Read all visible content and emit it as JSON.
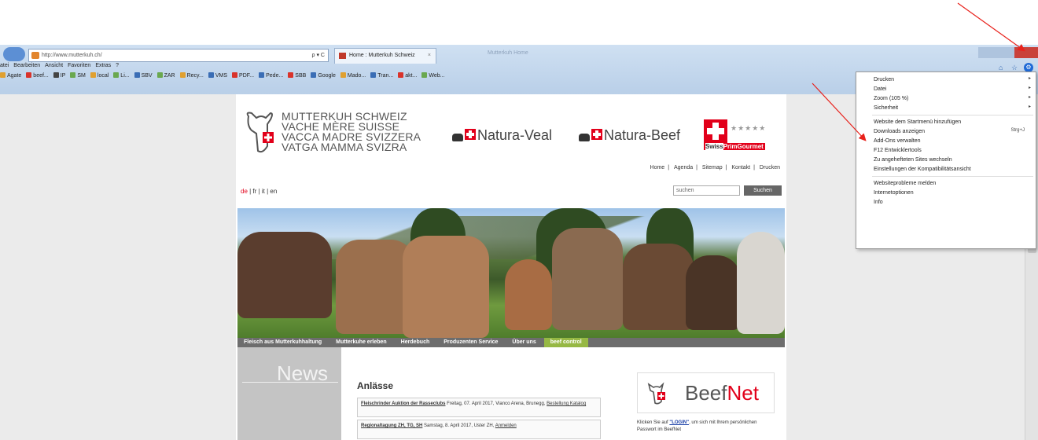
{
  "browser": {
    "address": "http://www.mutterkuh.ch/",
    "address_controls": "ρ ▾ C",
    "tab_label": "Home : Mutterkuh Schweiz",
    "tab_close": "×",
    "window_title": "Mutterkuh Home",
    "menu": [
      "atei",
      "Bearbeiten",
      "Ansicht",
      "Favoriten",
      "Extras",
      "?"
    ],
    "favorites": [
      "Agate",
      "beef...",
      "IP",
      "SM",
      "local",
      "Li...",
      "SBV",
      "ZAR",
      "Recy...",
      "VMS",
      "PDF...",
      "Pede...",
      "SBB",
      "Google",
      "Mado...",
      "Tran...",
      "akt...",
      "Web..."
    ]
  },
  "site": {
    "logo_lines": [
      "MUTTERKUH SCHWEIZ",
      "VACHE MÈRE SUISSE",
      "VACCA MADRE SVIZZERA",
      "VATGA MAMMA SVIZRA"
    ],
    "brand_veal": "Natura-Veal",
    "brand_beef": "Natura-Beef",
    "brand_spg_stars": "★★★★★",
    "brand_spg_label": "Swiss",
    "brand_spg_label2": "PrimGourmet",
    "topnav": [
      "Home",
      "Agenda",
      "Sitemap",
      "Kontakt",
      "Drucken"
    ],
    "topnav_sep": "|",
    "lang_active": "de",
    "lang_rest": " | fr | it | en",
    "search_placeholder": "suchen",
    "search_button": "Suchen",
    "menu": [
      "Fleisch aus Mutterkuhhaltung",
      "Mutterkuhe erleben",
      "Herdebuch",
      "Produzenten Service",
      "Über uns",
      "beef control"
    ],
    "news_title": "News",
    "anlaesse_title": "Anlässe",
    "events": [
      {
        "link": "Fleischrinder Auktion der Rasseclubs",
        "text": " Freitag, 07. April 2017, Vianco Arena, Brunegg, ",
        "extra": "Bestellung Katalog"
      },
      {
        "link": "Regionaltagung ZH, TG, SH",
        "text": " Samstag, 8. April 2017, Uster ZH, ",
        "extra": "Anmelden"
      }
    ],
    "beefnet_a": "Beef",
    "beefnet_b": "Net",
    "beefnet_text_a": "Klicken Sie auf ",
    "beefnet_text_login": "\"LOGIN\"",
    "beefnet_text_b": ", um sich mit Ihrem persönlichen Passwort im BeefNet"
  },
  "context_menu": {
    "items": [
      {
        "label": "Drucken",
        "submenu": true
      },
      {
        "label": "Datei",
        "submenu": true
      },
      {
        "label": "Zoom (105 %)",
        "submenu": true
      },
      {
        "label": "Sicherheit",
        "submenu": true
      },
      {
        "label": "Website dem Startmenü hinzufügen"
      },
      {
        "label": "Downloads anzeigen",
        "shortcut": "Strg+J"
      },
      {
        "label": "Add-Ons verwalten"
      },
      {
        "label": "F12 Entwicklertools"
      },
      {
        "label": "Zu angehefteten Sites wechseln"
      },
      {
        "label": "Einstellungen der Kompatibilitätsansicht"
      },
      {
        "label": "Websiteprobleme melden"
      },
      {
        "label": "Internetoptionen"
      },
      {
        "label": "Info"
      }
    ],
    "arrow_glyph": "▸"
  },
  "colors": {
    "accent_red": "#e2001a",
    "menu_highlight": "#96b844",
    "annotation_arrow": "#e8221c"
  }
}
